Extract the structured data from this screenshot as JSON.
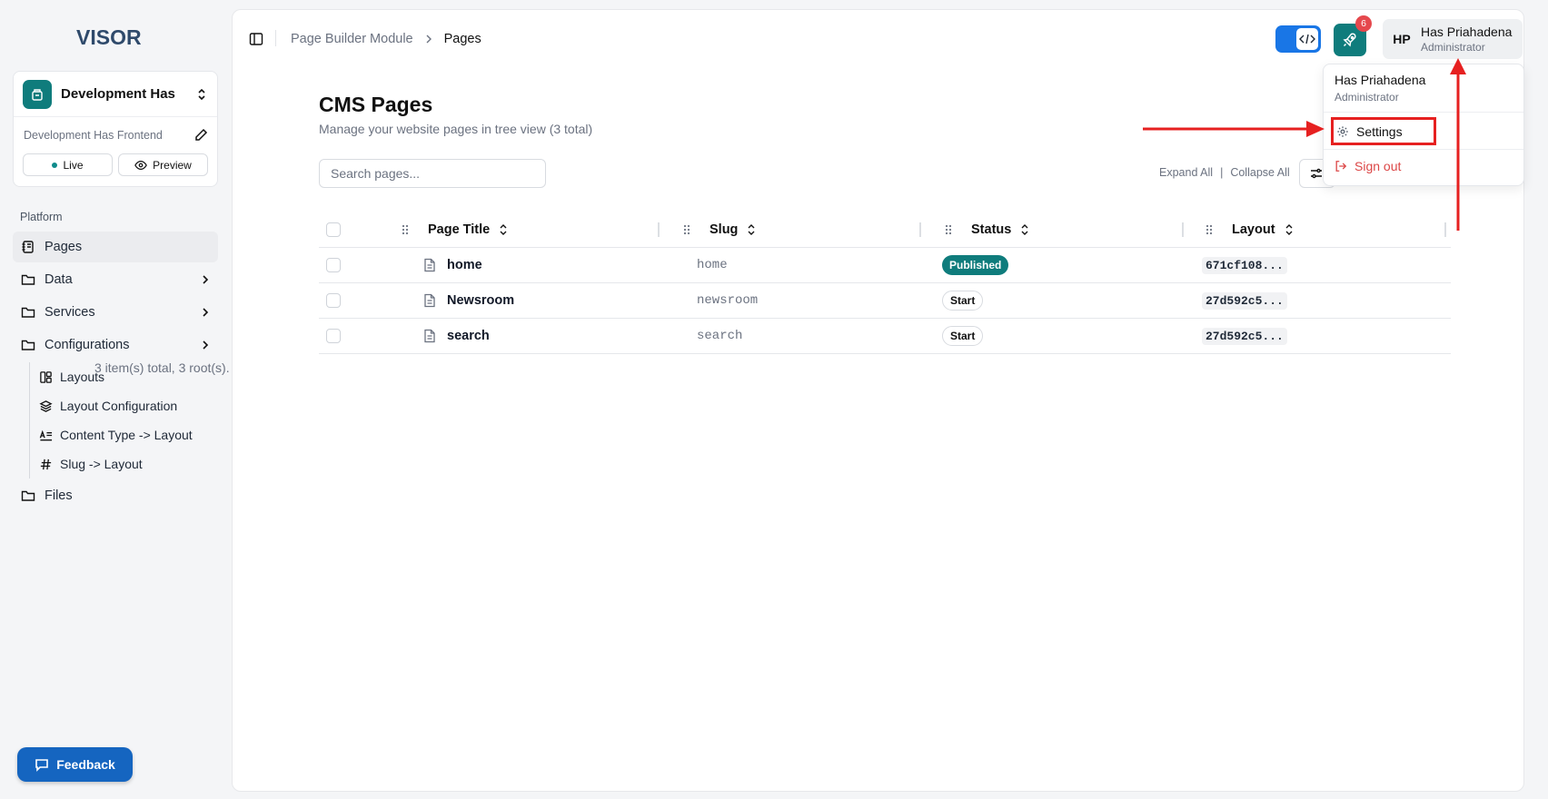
{
  "app": {
    "logo": "VISOR"
  },
  "project": {
    "name": "Development Has",
    "frontend": "Development Has Frontend",
    "live_label": "Live",
    "preview_label": "Preview"
  },
  "sidebar": {
    "section_label": "Platform",
    "items": [
      {
        "label": "Pages",
        "icon": "notebook-icon"
      },
      {
        "label": "Data",
        "icon": "folder-icon"
      },
      {
        "label": "Services",
        "icon": "folder-icon"
      },
      {
        "label": "Configurations",
        "icon": "folder-icon"
      }
    ],
    "sub_items": [
      {
        "label": "Layouts",
        "icon": "layout-dashboard-icon"
      },
      {
        "label": "Layout Configuration",
        "icon": "layers-icon"
      },
      {
        "label": "Content Type -> Layout",
        "icon": "text-align-icon"
      },
      {
        "label": "Slug -> Layout",
        "icon": "hash-icon"
      }
    ],
    "files_label": "Files",
    "feedback_label": "Feedback"
  },
  "header": {
    "breadcrumb": [
      "Page Builder Module",
      "Pages"
    ],
    "notification_count": "6",
    "user": {
      "initials": "HP",
      "name": "Has Priahadena",
      "role": "Administrator"
    }
  },
  "main": {
    "title": "CMS Pages",
    "subtitle": "Manage your website pages in tree view  (3 total)",
    "search_placeholder": "Search pages...",
    "expand_all": "Expand All",
    "separator": "|",
    "collapse_all": "Collapse All"
  },
  "table": {
    "columns": [
      "Page Title",
      "Slug",
      "Status",
      "Layout"
    ],
    "rows": [
      {
        "title": "home",
        "slug": "home",
        "status": "Published",
        "layout": "671cf108..."
      },
      {
        "title": "Newsroom",
        "slug": "newsroom",
        "status": "Start",
        "layout": "27d592c5..."
      },
      {
        "title": "search",
        "slug": "search",
        "status": "Start",
        "layout": "27d592c5..."
      }
    ],
    "footer": "3 item(s) total, 3 root(s)."
  },
  "dropdown": {
    "name": "Has Priahadena",
    "role": "Administrator",
    "settings_label": "Settings",
    "signout_label": "Sign out"
  },
  "colors": {
    "accent_teal": "#0f7c7c",
    "code_toggle_blue": "#1976e6",
    "annotation_red": "#e62020",
    "signout_red": "#dc4747"
  }
}
